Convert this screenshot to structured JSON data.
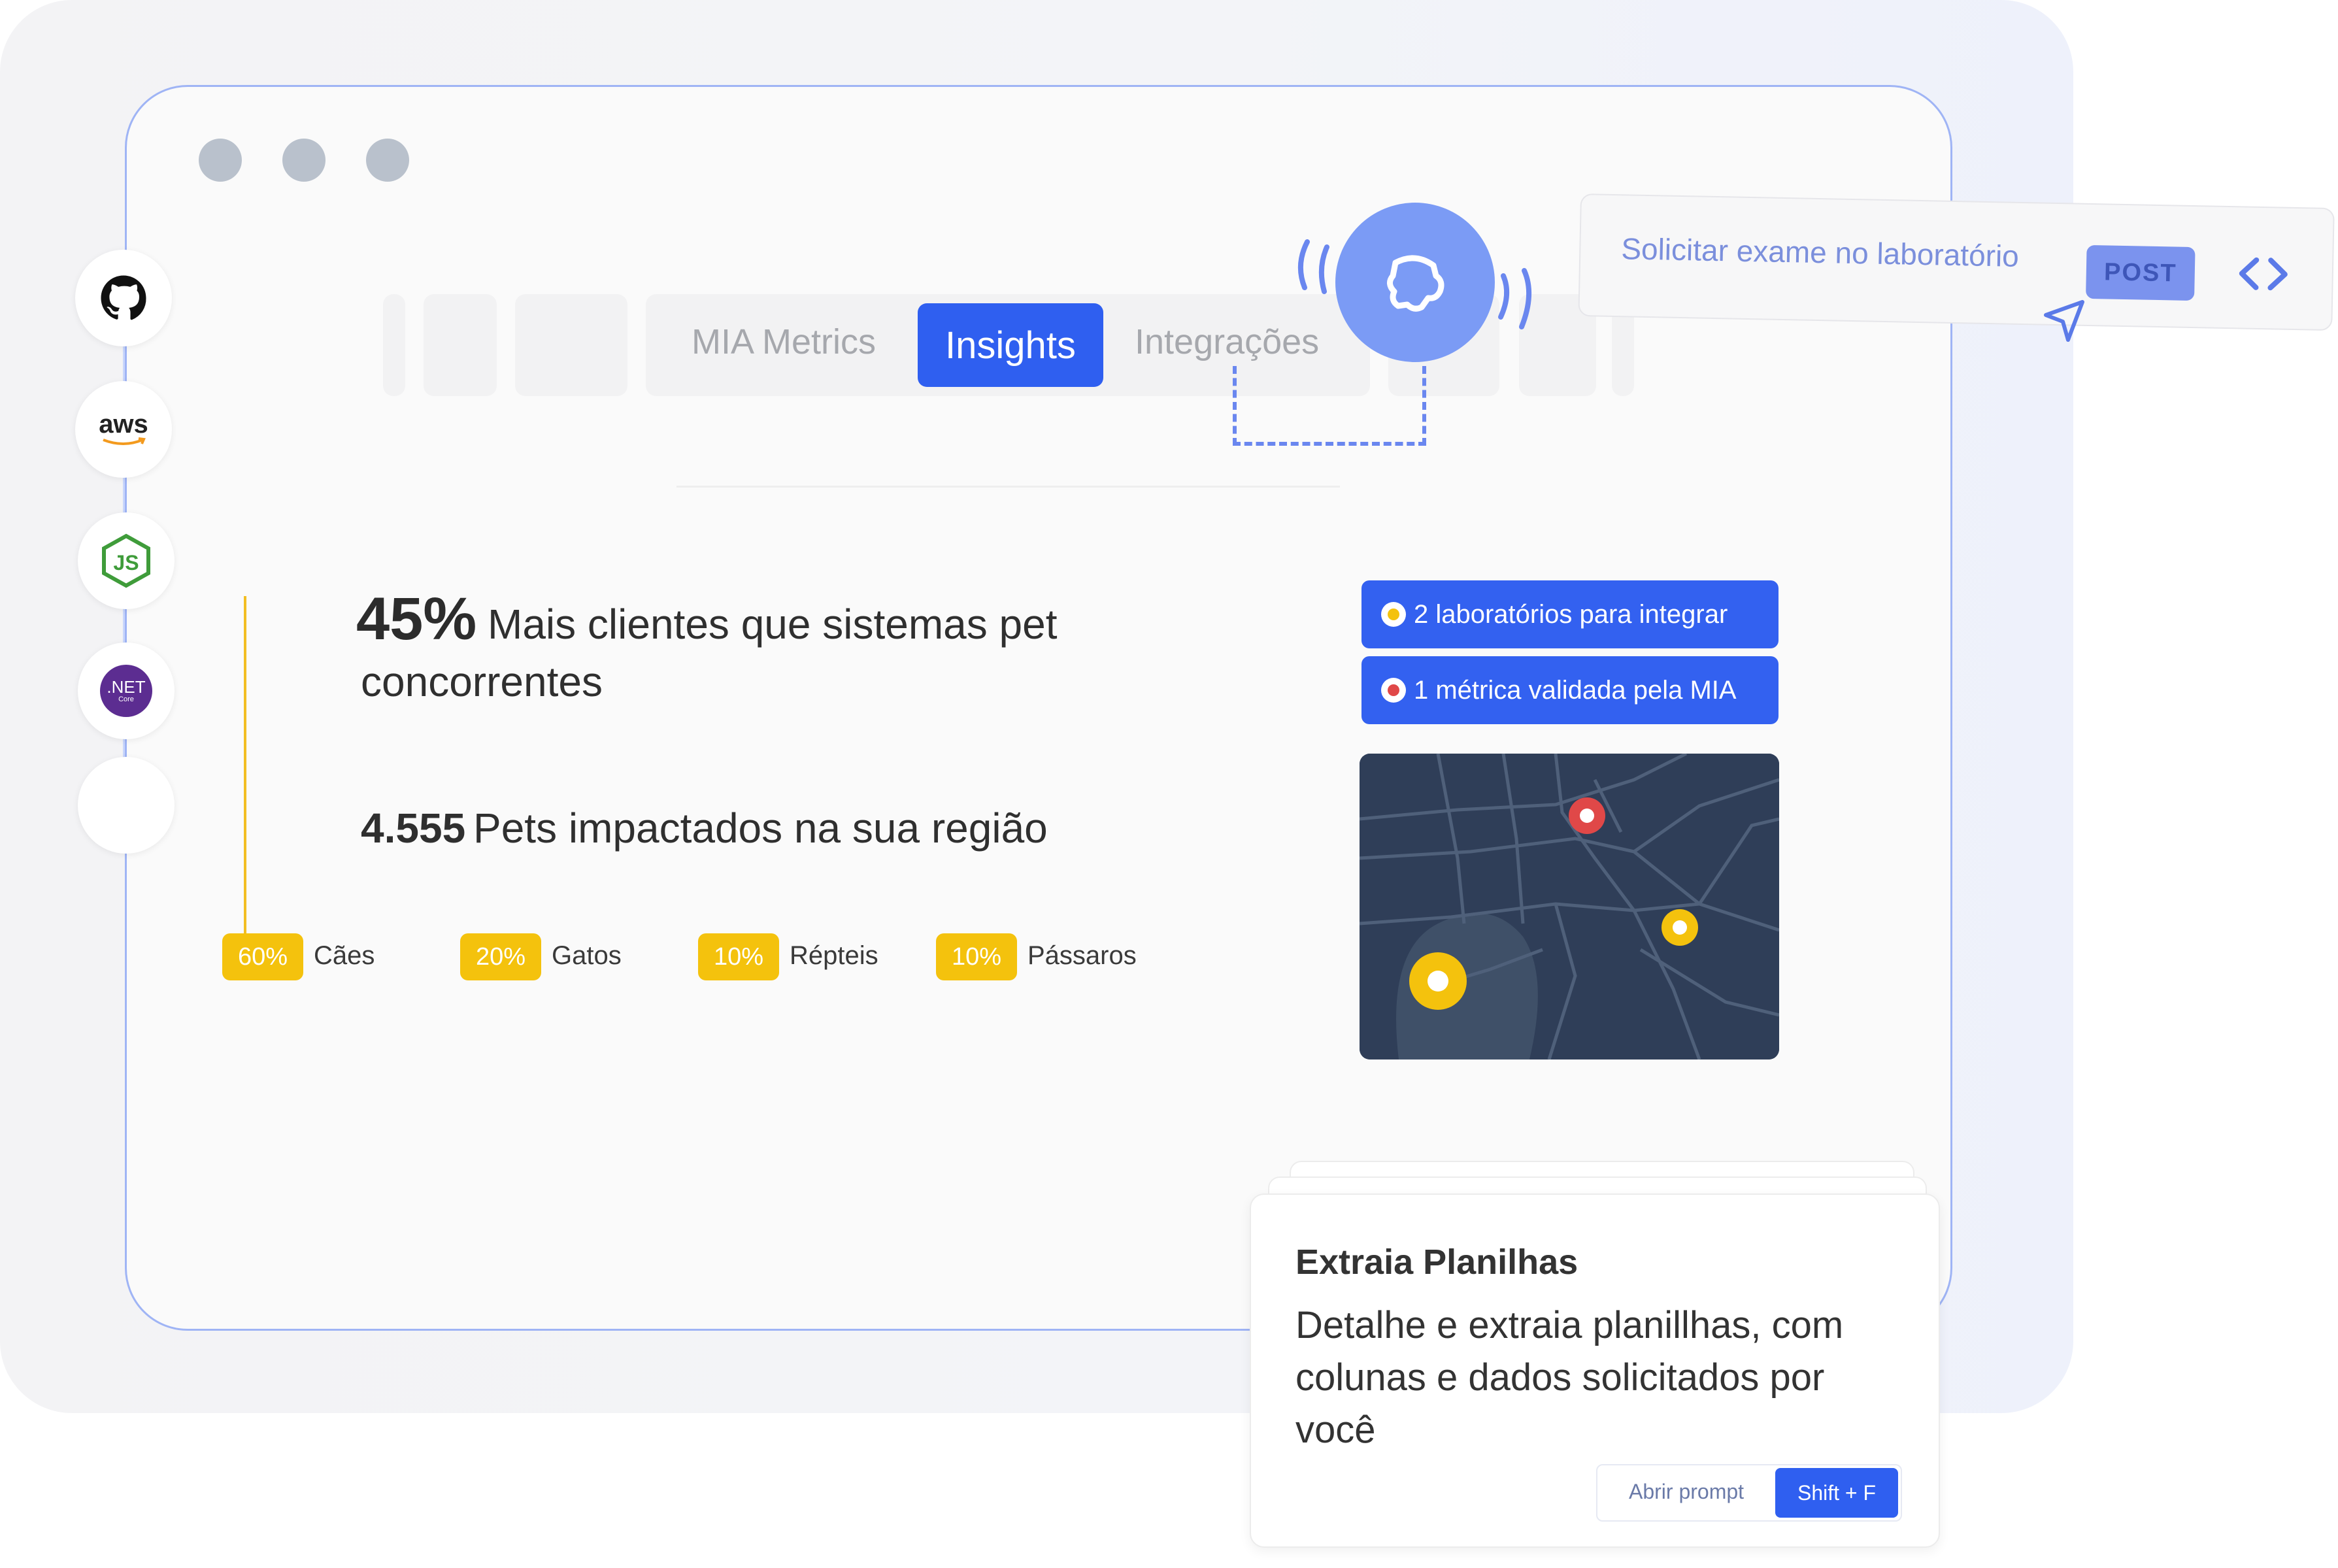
{
  "window": {
    "controls": [
      "dot-1",
      "dot-2",
      "dot-3"
    ]
  },
  "integrations": [
    {
      "name": "github",
      "icon": "github-icon"
    },
    {
      "name": "aws",
      "label": "aws",
      "icon": "aws-icon"
    },
    {
      "name": "nodejs",
      "label": "JS",
      "icon": "nodejs-icon"
    },
    {
      "name": "dotnet",
      "label": ".NET",
      "sublabel": "Core",
      "icon": "dotnet-core-icon"
    },
    {
      "name": "empty",
      "icon": ""
    }
  ],
  "tabs": {
    "items": [
      "MIA Metrics",
      "Insights",
      "Integrações"
    ],
    "active": "Insights"
  },
  "bot": {
    "icon": "bot-head-icon"
  },
  "request": {
    "text": "Solicitar exame no laboratório",
    "method": "POST",
    "icon": "code-icon",
    "cursor_icon": "send-arrow-icon"
  },
  "metrics": {
    "headline_pct": "45%",
    "headline_text_1": "Mais clientes que sistemas pet",
    "headline_text_2": "concorrentes",
    "pets_count": "4.555",
    "pets_text": "Pets impactados na sua região",
    "breakdown": [
      {
        "pct": "60%",
        "label": "Cães"
      },
      {
        "pct": "20%",
        "label": "Gatos"
      },
      {
        "pct": "10%",
        "label": "Répteis"
      },
      {
        "pct": "10%",
        "label": "Pássaros"
      }
    ]
  },
  "info_pills": [
    {
      "text": "2 laboratórios para integrar",
      "dot_color": "#f4c20d"
    },
    {
      "text": "1 métrica validada pela MIA",
      "dot_color": "#e04848"
    }
  ],
  "map": {
    "markers": [
      "red-marker",
      "yellow-marker",
      "yellow-marker-large"
    ]
  },
  "card": {
    "title": "Extraia Planilhas",
    "description": "Detalhe e extraia planillhas, com colunas e dados solicitados por você",
    "prompt_label": "Abrir prompt",
    "shortcut": "Shift + F"
  },
  "colors": {
    "accent_blue": "#2f5ff0",
    "accent_yellow": "#f4c20d",
    "marker_red": "#e04848",
    "map_bg": "#2f3e58"
  }
}
